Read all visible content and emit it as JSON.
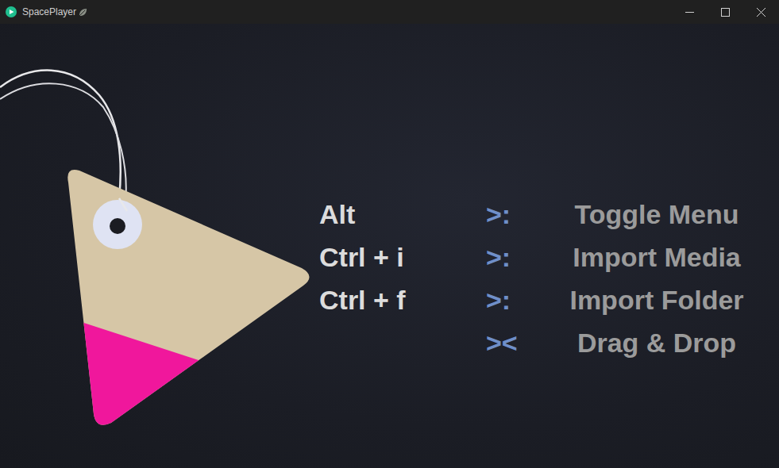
{
  "window": {
    "title": "SpacePlayer"
  },
  "shortcuts": [
    {
      "keys": "Alt",
      "separator": ">:",
      "action": "Toggle Menu"
    },
    {
      "keys": "Ctrl + i",
      "separator": ">:",
      "action": "Import Media"
    },
    {
      "keys": "Ctrl + f",
      "separator": ">:",
      "action": "Import Folder"
    },
    {
      "separator": "><",
      "action": "Drag & Drop"
    }
  ]
}
